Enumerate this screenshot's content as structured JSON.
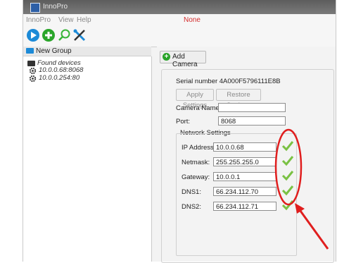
{
  "window": {
    "title": "InnoPro"
  },
  "menu": {
    "items": [
      "InnoPro",
      "View",
      "Help"
    ],
    "mode": "None"
  },
  "toolbar": {
    "icons": [
      "play-icon",
      "add-icon",
      "search-icon",
      "tools-icon"
    ]
  },
  "tree": {
    "group": "New Group",
    "found": "Found devices",
    "devices": [
      "10.0.0.68:8068",
      "10.0.0.254:80"
    ]
  },
  "panel": {
    "add_camera": "Add Camera",
    "serial": "Serial number 4A000F5796111E8B",
    "apply": "Apply Settings",
    "restore": "Restore Settings",
    "camera_name_label": "Camera Name:",
    "camera_name_value": "",
    "port_label": "Port:",
    "port_value": "8068",
    "network_title": "Network Settings",
    "rows": [
      {
        "label": "IP Address:",
        "value": "10.0.0.68"
      },
      {
        "label": "Netmask:",
        "value": "255.255.255.0"
      },
      {
        "label": "Gateway:",
        "value": "10.0.0.1"
      },
      {
        "label": "DNS1:",
        "value": "66.234.112.70"
      },
      {
        "label": "DNS2:",
        "value": "66.234.112.71"
      }
    ]
  },
  "colors": {
    "check": "#7ac143",
    "annotation": "#e01e1e",
    "accent": "#1c8ad7",
    "mode": "#d22b2b"
  }
}
